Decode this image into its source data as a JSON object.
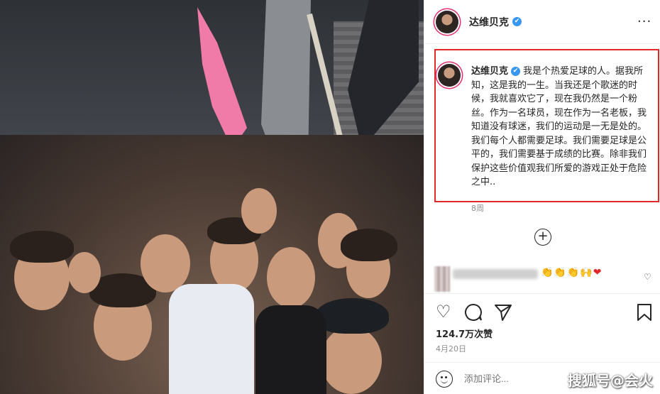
{
  "post": {
    "username": "达维贝克",
    "verified_mark": "✔",
    "more_icon": "more-icon",
    "caption": "我是个热爱足球的人。据我所知，这是我的一生。当我还是个歌迷的时候，我就喜欢它了，现在我仍然是一个粉丝。作为一名球员，现在作为一名老板，我知道没有球迷，我们的运动是一无是处的。我们每个人都需要足球。我们需要足球是公平的，我们需要基于成绩的比赛。除非我们保护这些价值观我们所爱的游戏正处于危险之中..",
    "time_ago": "8周",
    "add_icon": "+",
    "comment_emojis": "👏👏👏🙌",
    "comment_heart": "❤",
    "likes": "124.7万次赞",
    "date": "4月20日",
    "comment_placeholder": "添加评论...",
    "highlight_color": "#e0282b",
    "verified_color": "#3897f0"
  },
  "actions": {
    "like_icon": "♡",
    "comment_icon": "◯",
    "share_icon": "➢",
    "save_icon": "⌑",
    "comment_like_icon": "♡"
  },
  "watermark": "搜狐号@会火"
}
